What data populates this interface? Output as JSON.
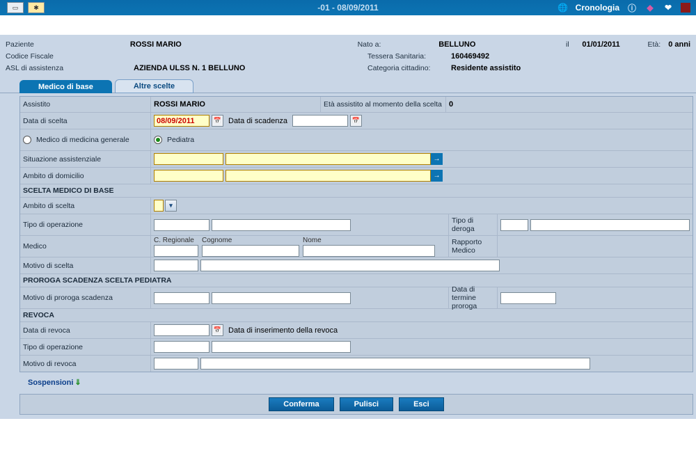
{
  "titlebar": {
    "title": "-01 - 08/09/2011",
    "cronologia": "Cronologia"
  },
  "patient": {
    "labels": {
      "paziente": "Paziente",
      "codice_fiscale": "Codice Fiscale",
      "asl": "ASL di assistenza",
      "nato_a": "Nato a:",
      "il": "il",
      "eta": "Età:",
      "tessera": "Tessera Sanitaria:",
      "categoria": "Categoria cittadino:"
    },
    "values": {
      "paziente": "ROSSI MARIO",
      "codice_fiscale": "",
      "asl": "AZIENDA ULSS N. 1 BELLUNO",
      "nato_a": "BELLUNO",
      "data_nascita": "01/01/2011",
      "eta": "0 anni",
      "tessera": "160469492",
      "categoria": "Residente assistito"
    }
  },
  "tabs": {
    "medico_di_base": "Medico di base",
    "altre_scelte": "Altre scelte"
  },
  "form": {
    "assistito_label": "Assistito",
    "assistito_value": "ROSSI MARIO",
    "eta_scelta_label": "Età assistito al momento della scelta",
    "eta_scelta_value": "0",
    "data_scelta_label": "Data di scelta",
    "data_scelta_value": "08/09/2011",
    "data_scadenza_label": "Data di scadenza",
    "data_scadenza_value": "",
    "radio_mmg": "Medico di medicina generale",
    "radio_pediatra": "Pediatra",
    "situazione_label": "Situazione assistenziale",
    "ambito_dom_label": "Ambito di domicilio",
    "section_scelta": "SCELTA MEDICO DI BASE",
    "ambito_scelta_label": "Ambito di scelta",
    "tipo_op_label": "Tipo di operazione",
    "tipo_deroga_label": "Tipo di deroga",
    "medico_label": "Medico",
    "c_regionale": "C. Regionale",
    "cognome": "Cognome",
    "nome": "Nome",
    "rapporto_label": "Rapporto Medico",
    "motivo_scelta_label": "Motivo di scelta",
    "section_proroga": "PROROGA SCADENZA SCELTA PEDIATRA",
    "motivo_proroga_label": "Motivo di proroga scadenza",
    "data_termine_label": "Data di termine proroga",
    "section_revoca": "REVOCA",
    "data_revoca_label": "Data di revoca",
    "data_ins_revoca_label": "Data di inserimento della revoca",
    "tipo_op_revoca_label": "Tipo di operazione",
    "motivo_revoca_label": "Motivo di revoca",
    "sospensioni": "Sospensioni"
  },
  "buttons": {
    "conferma": "Conferma",
    "pulisci": "Pulisci",
    "esci": "Esci"
  }
}
